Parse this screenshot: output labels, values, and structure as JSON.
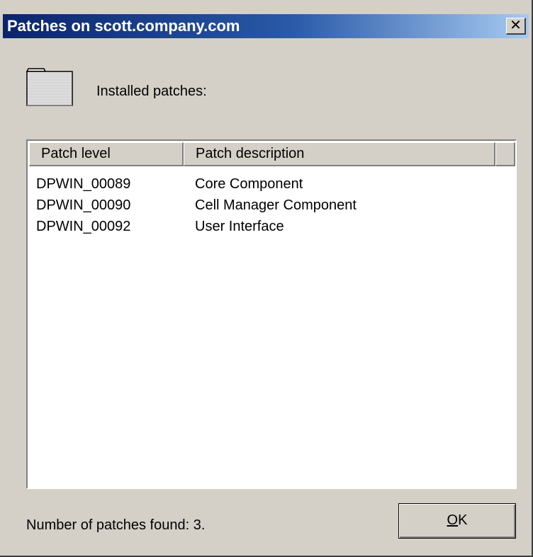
{
  "window": {
    "title": "Patches on scott.company.com",
    "close_icon": "close-icon"
  },
  "heading": {
    "icon": "folder-icon",
    "label": "Installed patches:"
  },
  "table": {
    "columns": [
      "Patch level",
      "Patch description"
    ],
    "rows": [
      {
        "level": "DPWIN_00089",
        "description": "Core Component"
      },
      {
        "level": "DPWIN_00090",
        "description": "Cell Manager Component"
      },
      {
        "level": "DPWIN_00092",
        "description": "User Interface"
      }
    ]
  },
  "footer": {
    "status": "Number of patches found: 3.",
    "ok_mnemonic": "O",
    "ok_rest": "K"
  },
  "colors": {
    "title_gradient_start": "#0a246a",
    "title_gradient_end": "#a6caf0",
    "dialog_face": "#d4d0c8"
  }
}
